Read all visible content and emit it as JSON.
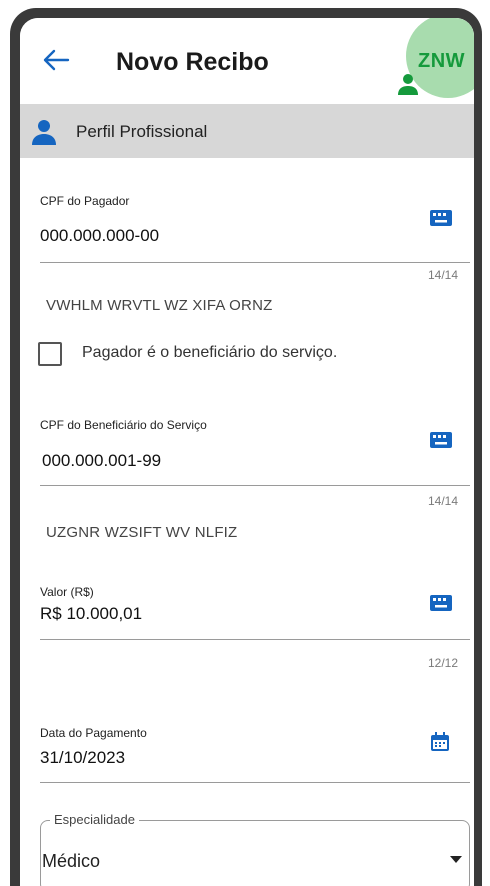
{
  "header": {
    "title": "Novo Recibo",
    "avatar_initials": "ZNW",
    "accent_color": "#1565c0",
    "avatar_color": "#159a3c"
  },
  "section": {
    "label": "Perfil Profissional"
  },
  "payer": {
    "label": "CPF do Pagador",
    "value": "000.000.000-00",
    "counter": "14/14",
    "name": "VWHLM WRVTL WZ XIFA ORNZ"
  },
  "checkbox": {
    "label": "Pagador é o beneficiário do serviço.",
    "checked": false
  },
  "beneficiary": {
    "label": "CPF do Beneficiário do Serviço",
    "value": "000.000.001-99",
    "counter": "14/14",
    "name": "UZGNR WZSIFT WV NLFIZ"
  },
  "amount": {
    "label": "Valor (R$)",
    "value": "R$ 10.000,01",
    "counter": "12/12"
  },
  "payment_date": {
    "label": "Data do Pagamento",
    "value": "31/10/2023"
  },
  "specialty": {
    "legend": "Especialidade",
    "value": "Médico"
  }
}
